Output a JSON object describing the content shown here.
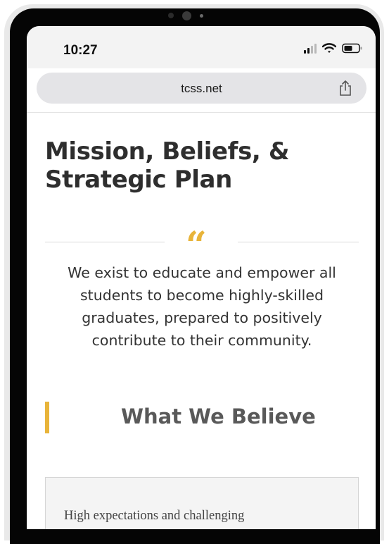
{
  "status_bar": {
    "time": "10:27",
    "icons": [
      "cellular-signal-icon",
      "wifi-icon",
      "battery-icon"
    ]
  },
  "browser": {
    "url": "tcss.net",
    "share_icon": "share-icon"
  },
  "page": {
    "title": "Mission, Beliefs, & Strategic Plan",
    "quote_mark": "“",
    "mission_statement": "We exist to educate and empower all students to become highly-skilled graduates, prepared to positively contribute to their community.",
    "section_heading": "What We Believe",
    "belief_card_text": "High expectations and challenging"
  },
  "colors": {
    "accent": "#e8b43a",
    "title_text": "#2e2e2e",
    "body_text": "#333333",
    "heading_gray": "#595959",
    "url_bar_bg": "#e4e4e7"
  }
}
